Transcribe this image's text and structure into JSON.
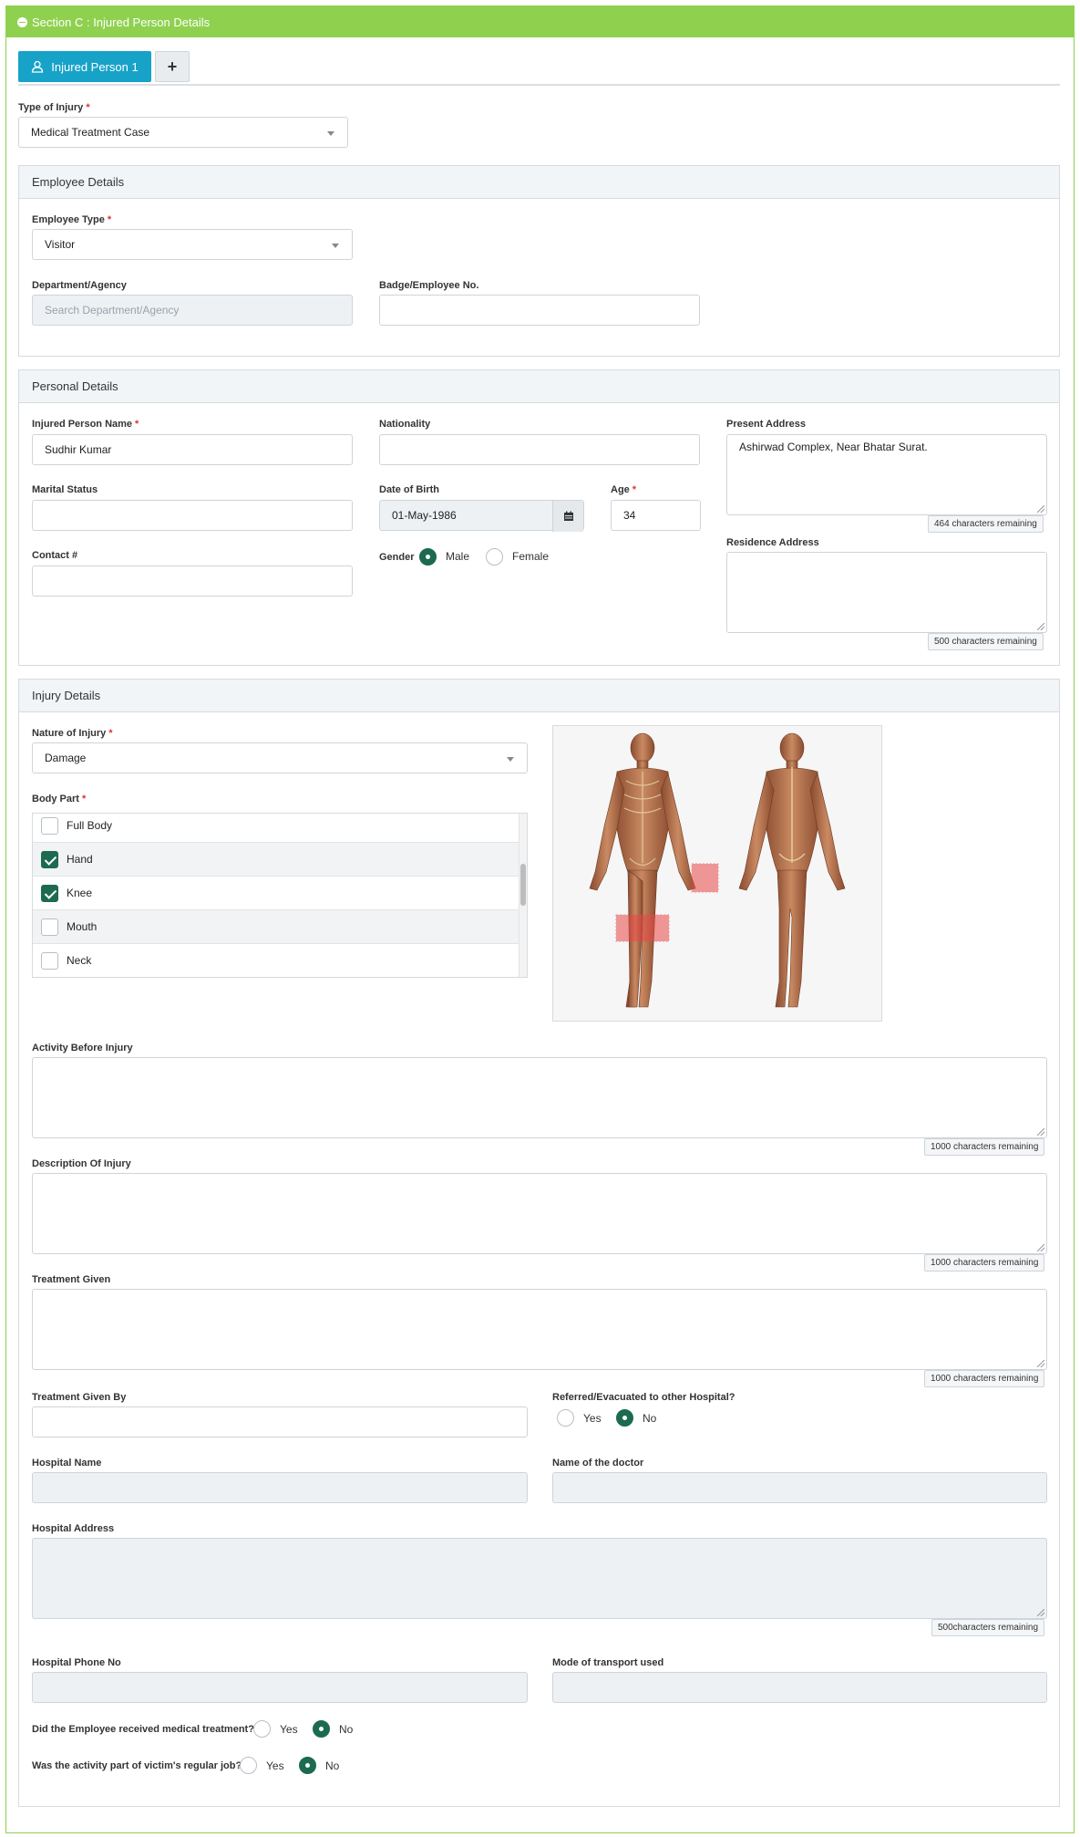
{
  "section": {
    "title": "Section C : Injured Person Details"
  },
  "tabs": {
    "person1_label": "Injured Person 1",
    "add_label": "+"
  },
  "type_of_injury": {
    "label": "Type of Injury",
    "value": "Medical Treatment Case"
  },
  "employee_details": {
    "title": "Employee Details",
    "employee_type": {
      "label": "Employee Type",
      "value": "Visitor"
    },
    "department": {
      "label": "Department/Agency",
      "placeholder": "Search Department/Agency"
    },
    "badge": {
      "label": "Badge/Employee No.",
      "value": ""
    }
  },
  "personal_details": {
    "title": "Personal Details",
    "name": {
      "label": "Injured Person Name",
      "value": "Sudhir Kumar"
    },
    "nationality": {
      "label": "Nationality",
      "value": ""
    },
    "present_address": {
      "label": "Present Address",
      "value": "Ashirwad Complex, Near Bhatar Surat.",
      "counter": "464 characters remaining"
    },
    "marital_status": {
      "label": "Marital Status",
      "value": ""
    },
    "dob": {
      "label": "Date of Birth",
      "value": "01-May-1986"
    },
    "age": {
      "label": "Age",
      "value": "34"
    },
    "contact": {
      "label": "Contact #",
      "value": ""
    },
    "gender": {
      "label": "Gender",
      "options": [
        "Male",
        "Female"
      ],
      "selected": "Male"
    },
    "residence_address": {
      "label": "Residence Address",
      "value": "",
      "counter": "500 characters remaining"
    }
  },
  "injury_details": {
    "title": "Injury Details",
    "nature": {
      "label": "Nature of Injury",
      "value": "Damage"
    },
    "body_part": {
      "label": "Body Part",
      "items": [
        {
          "label": "Full Body",
          "checked": false
        },
        {
          "label": "Hand",
          "checked": true
        },
        {
          "label": "Knee",
          "checked": true
        },
        {
          "label": "Mouth",
          "checked": false
        },
        {
          "label": "Neck",
          "checked": false
        }
      ]
    },
    "activity_before": {
      "label": "Activity Before Injury",
      "counter": "1000 characters remaining"
    },
    "description": {
      "label": "Description Of Injury",
      "counter": "1000 characters remaining"
    },
    "treatment_given": {
      "label": "Treatment Given",
      "counter": "1000 characters remaining"
    },
    "treatment_given_by": {
      "label": "Treatment Given By",
      "value": ""
    },
    "referred": {
      "label": "Referred/Evacuated to other Hospital?",
      "options": [
        "Yes",
        "No"
      ],
      "selected": "No"
    },
    "hospital_name": {
      "label": "Hospital Name"
    },
    "doctor_name": {
      "label": "Name of the doctor"
    },
    "hospital_address": {
      "label": "Hospital Address",
      "counter": "500characters remaining"
    },
    "hospital_phone": {
      "label": "Hospital Phone No"
    },
    "transport": {
      "label": "Mode of transport used"
    },
    "received_treatment": {
      "label": "Did the Employee received medical treatment?",
      "options": [
        "Yes",
        "No"
      ],
      "selected": "No"
    },
    "regular_job": {
      "label": "Was the activity part of victim's regular job?",
      "options": [
        "Yes",
        "No"
      ],
      "selected": "No"
    }
  },
  "colors": {
    "header_green": "#8fd14f",
    "tab_blue": "#17a2c8",
    "selected_green": "#1c6b50",
    "highlight_red": "#e8484866"
  }
}
